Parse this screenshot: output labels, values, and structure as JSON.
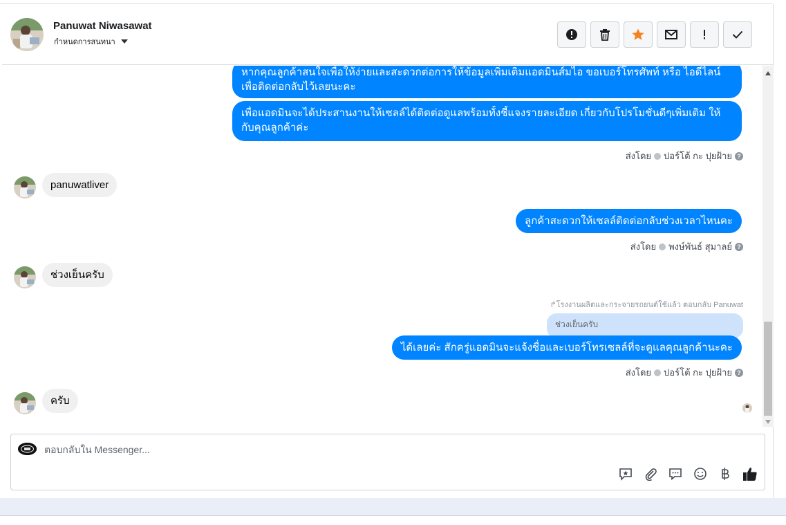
{
  "header": {
    "contact_name": "Panuwat Niwasawat",
    "assign_label": "กำหนดการสนทนา",
    "actions": [
      {
        "name": "mark-spam-button",
        "icon": "alert-circle-icon"
      },
      {
        "name": "delete-button",
        "icon": "trash-icon"
      },
      {
        "name": "star-button",
        "icon": "star-icon"
      },
      {
        "name": "mark-unread-button",
        "icon": "envelope-icon"
      },
      {
        "name": "follow-up-button",
        "icon": "exclamation-icon"
      },
      {
        "name": "mark-done-button",
        "icon": "check-icon"
      }
    ]
  },
  "messages": {
    "m1_line1": "หากคุณลูกค้าสนใจเพื่อให้ง่ายและสะดวกต่อการให้ข้อมูลเพิ่มเติมแอดมินส์มไอ ขอเบอร์โทรศัพท์ หรือ ไอดีไลน์",
    "m1_line2": "เพื่อติดต่อกลับไว้เลยนะคะ",
    "m2_line1": "เพื่อแอดมินจะได้ประสานงานให้เซลล์ได้ติดต่อดูแลพร้อมทั้งชี้แจงรายละเอียด เกี่ยวกับโปรโมชั่นดีๆเพิ่มเติม ให้",
    "m2_line2": "กับคุณลูกค้าค่ะ",
    "sent1_prefix": "ส่งโดย",
    "sent1_name": "ปอร์โต้ กะ ปุยฝ้าย",
    "in1": "panuwatliver",
    "m3": "ลูกค้าสะดวกให้เซลล์ติดต่อกลับช่วงเวลาไหนคะ",
    "sent2_prefix": "ส่งโดย",
    "sent2_name": "พงษ์พันธ์ สุมาลย์",
    "in2": "ช่วงเย็นครับ",
    "replied_note": "โรงงานผลิตและกระจายรถยนต์ใช้แล้ว ตอบกลับ Panuwat",
    "quoted": "ช่วงเย็นครับ",
    "m4": "ได้เลยค่ะ สักครู่แอดมินจะแจ้งชื่อและเบอร์โทรเซลล์ที่จะดูแลคุณลูกค้านะคะ",
    "sent3_prefix": "ส่งโดย",
    "sent3_name": "ปอร์โต้ กะ ปุยฝ้าย",
    "in3": "ครับ"
  },
  "composer": {
    "placeholder": "ตอบกลับใน Messenger...",
    "tools": [
      "saved-reply-icon",
      "attachment-icon",
      "chat-bubble-icon",
      "emoji-icon",
      "baht-icon",
      "thumbs-up-icon"
    ]
  },
  "colors": {
    "outgoing_bubble": "#0084ff",
    "incoming_bubble": "#f0f0f0",
    "star": "#f5821f"
  }
}
